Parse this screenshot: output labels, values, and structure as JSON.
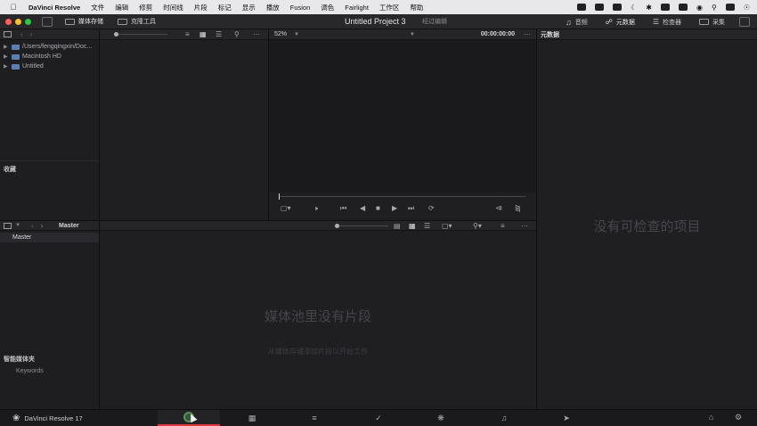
{
  "menubar": {
    "app_name": "DaVinci Resolve",
    "items": [
      "文件",
      "编辑",
      "修剪",
      "时间线",
      "片段",
      "标记",
      "显示",
      "播放",
      "Fusion",
      "调色",
      "Fairlight",
      "工作区",
      "帮助"
    ]
  },
  "toolbar": {
    "media_storage": "媒体存储",
    "clone_tool": "克隆工具",
    "project_title": "Untitled Project 3",
    "project_status": "经过编辑",
    "audio": "音频",
    "metadata": "元数据",
    "inspector": "检查器",
    "capture": "采集"
  },
  "media_storage_panel": {
    "locations": [
      "/Users/fengqingxin/Doc...",
      "Macintosh HD",
      "Untitled"
    ],
    "favorites_label": "收藏"
  },
  "viewer": {
    "zoom": "52%",
    "timecode": "00:00:00:00"
  },
  "metadata_panel": {
    "title": "元数据",
    "empty_message": "没有可检查的项目"
  },
  "media_pool": {
    "bin_name": "Master",
    "master_bin": "Master",
    "smart_bins_label": "智能媒体夹",
    "keywords": "Keywords",
    "empty_title": "媒体池里没有片段",
    "empty_hint": "从媒体存储添加片段以开始工作"
  },
  "pagebar": {
    "brand": "DaVinci Resolve 17"
  },
  "colors": {
    "accent_red": "#e0383a",
    "traffic_red": "#ff5f57",
    "traffic_yellow": "#febc2e",
    "traffic_green": "#28c840"
  }
}
